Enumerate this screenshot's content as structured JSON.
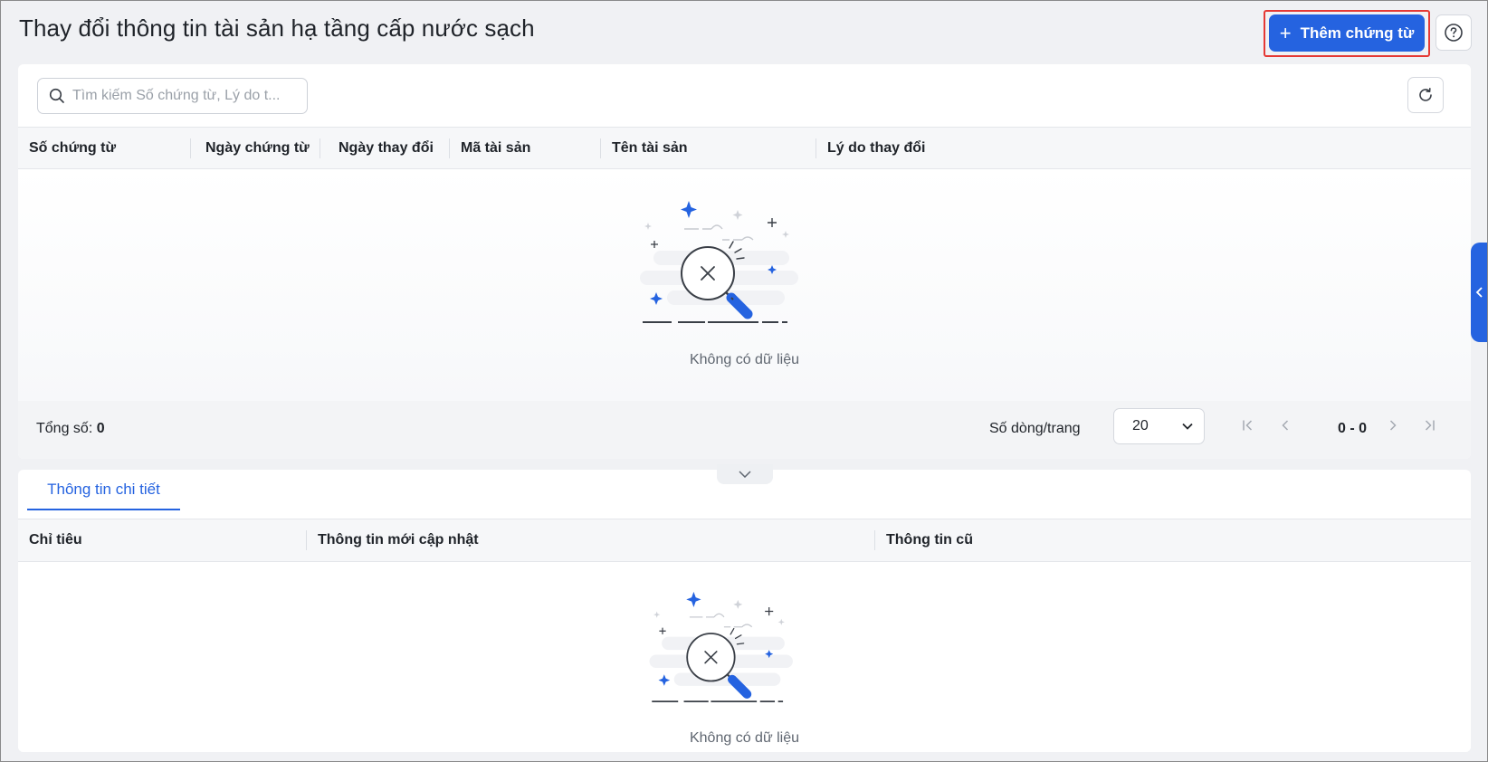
{
  "header": {
    "title": "Thay đổi thông tin tài sản hạ tầng cấp nước sạch",
    "add_button_label": "Thêm chứng từ"
  },
  "search": {
    "placeholder": "Tìm kiếm Số chứng từ, Lý do t..."
  },
  "main_table": {
    "columns": [
      "Số chứng từ",
      "Ngày chứng từ",
      "Ngày thay đổi",
      "Mã tài sản",
      "Tên tài sản",
      "Lý do thay đổi"
    ],
    "empty_text": "Không có dữ liệu"
  },
  "footer": {
    "total_label": "Tổng số:",
    "total_value": "0",
    "rows_per_page_label": "Số dòng/trang",
    "rows_per_page_value": "20",
    "page_range": "0 - 0"
  },
  "detail": {
    "tab_label": "Thông tin chi tiết",
    "columns": [
      "Chỉ tiêu",
      "Thông tin mới cập nhật",
      "Thông tin cũ"
    ],
    "empty_text": "Không có dữ liệu"
  },
  "colors": {
    "accent": "#2563e0",
    "highlight": "#e53935"
  },
  "icons": {
    "add": "plus-icon",
    "help": "question-circle-icon",
    "search": "search-icon",
    "refresh": "refresh-icon",
    "empty": "magnifier-no-data-illustration",
    "pager": [
      "first-page-icon",
      "prev-page-icon",
      "next-page-icon",
      "last-page-icon"
    ],
    "collapse": "chevron-down-icon",
    "side": "chevron-left-icon"
  }
}
